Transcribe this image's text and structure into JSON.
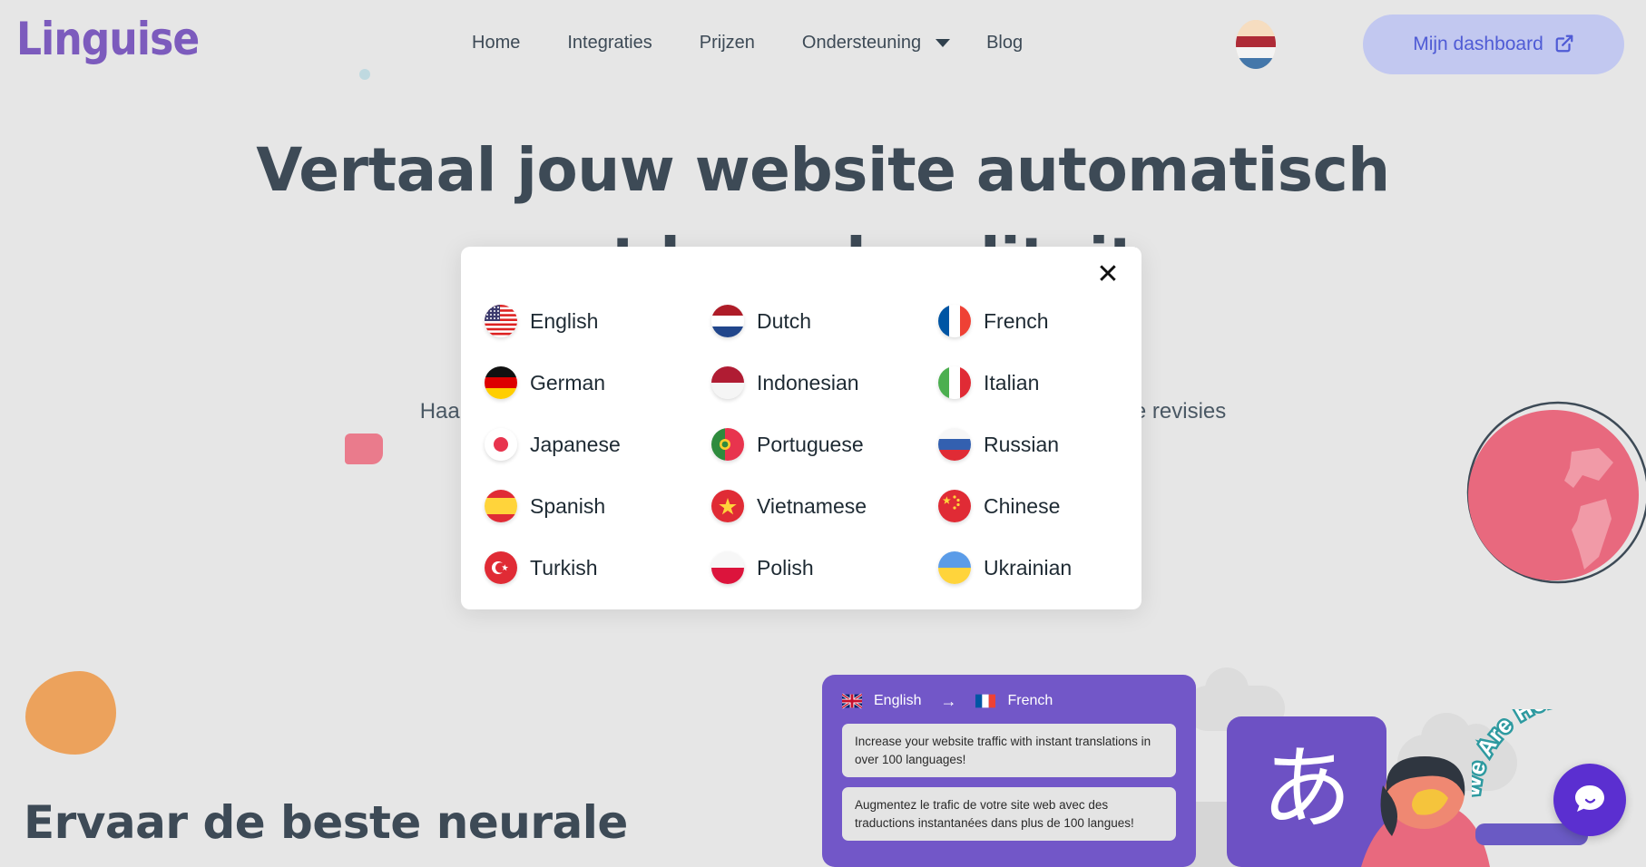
{
  "brand": {
    "name": "Linguise"
  },
  "header": {
    "nav": [
      {
        "label": "Home",
        "caret": false
      },
      {
        "label": "Integraties",
        "caret": false
      },
      {
        "label": "Prijzen",
        "caret": false
      },
      {
        "label": "Ondersteuning",
        "caret": true
      },
      {
        "label": "Blog",
        "caret": false
      }
    ],
    "language_switcher": {
      "icon": "dutch-flag-icon",
      "current": "Dutch"
    },
    "dashboard_button": {
      "label": "Mijn dashboard",
      "icon": "external-link-icon"
    },
    "colors": {
      "logo": "#7c5bbd",
      "dashboard_bg": "#c2c8f0",
      "dashboard_text": "#4f5bd5"
    }
  },
  "hero": {
    "title_line1": "Vertaal jouw website automatisch",
    "title_line2": "met hoge kwaliteit",
    "subtitle": "Haal het beste uit de automatische vertaling, ondersteund door handmatige revisies",
    "colors": {
      "heading": "#3d4a56",
      "body": "#4a5864"
    }
  },
  "modal": {
    "close_label": "✕",
    "languages": [
      {
        "name": "English",
        "flag": "flag-us"
      },
      {
        "name": "Dutch",
        "flag": "flag-nl"
      },
      {
        "name": "French",
        "flag": "flag-fr"
      },
      {
        "name": "German",
        "flag": "flag-de"
      },
      {
        "name": "Indonesian",
        "flag": "flag-id"
      },
      {
        "name": "Italian",
        "flag": "flag-it"
      },
      {
        "name": "Japanese",
        "flag": "flag-jp"
      },
      {
        "name": "Portuguese",
        "flag": "flag-pt"
      },
      {
        "name": "Russian",
        "flag": "flag-ru"
      },
      {
        "name": "Spanish",
        "flag": "flag-es"
      },
      {
        "name": "Vietnamese",
        "flag": "flag-vn"
      },
      {
        "name": "Chinese",
        "flag": "flag-cn"
      },
      {
        "name": "Turkish",
        "flag": "flag-tr"
      },
      {
        "name": "Polish",
        "flag": "flag-pl"
      },
      {
        "name": "Ukrainian",
        "flag": "flag-ua"
      }
    ]
  },
  "section": {
    "title": "Ervaar de beste neurale"
  },
  "illustration": {
    "translate_card": {
      "source_language": "English",
      "source_flag": "flag-gb",
      "arrow": "→",
      "target_language": "French",
      "target_flag": "flag-fr",
      "source_text": "Increase your website traffic with instant translations in over 100 languages!",
      "target_text": "Augmentez le trafic de votre site web avec des traductions instantanées dans plus de 100 langues!",
      "bg_color": "#7257c8"
    },
    "japanese_card": {
      "character": "あ",
      "bg_color": "#6d51c4"
    }
  },
  "chat": {
    "tooltip": "We Are Here!",
    "icon": "chat-bubble-icon",
    "bg_color": "#5b2fd0"
  }
}
